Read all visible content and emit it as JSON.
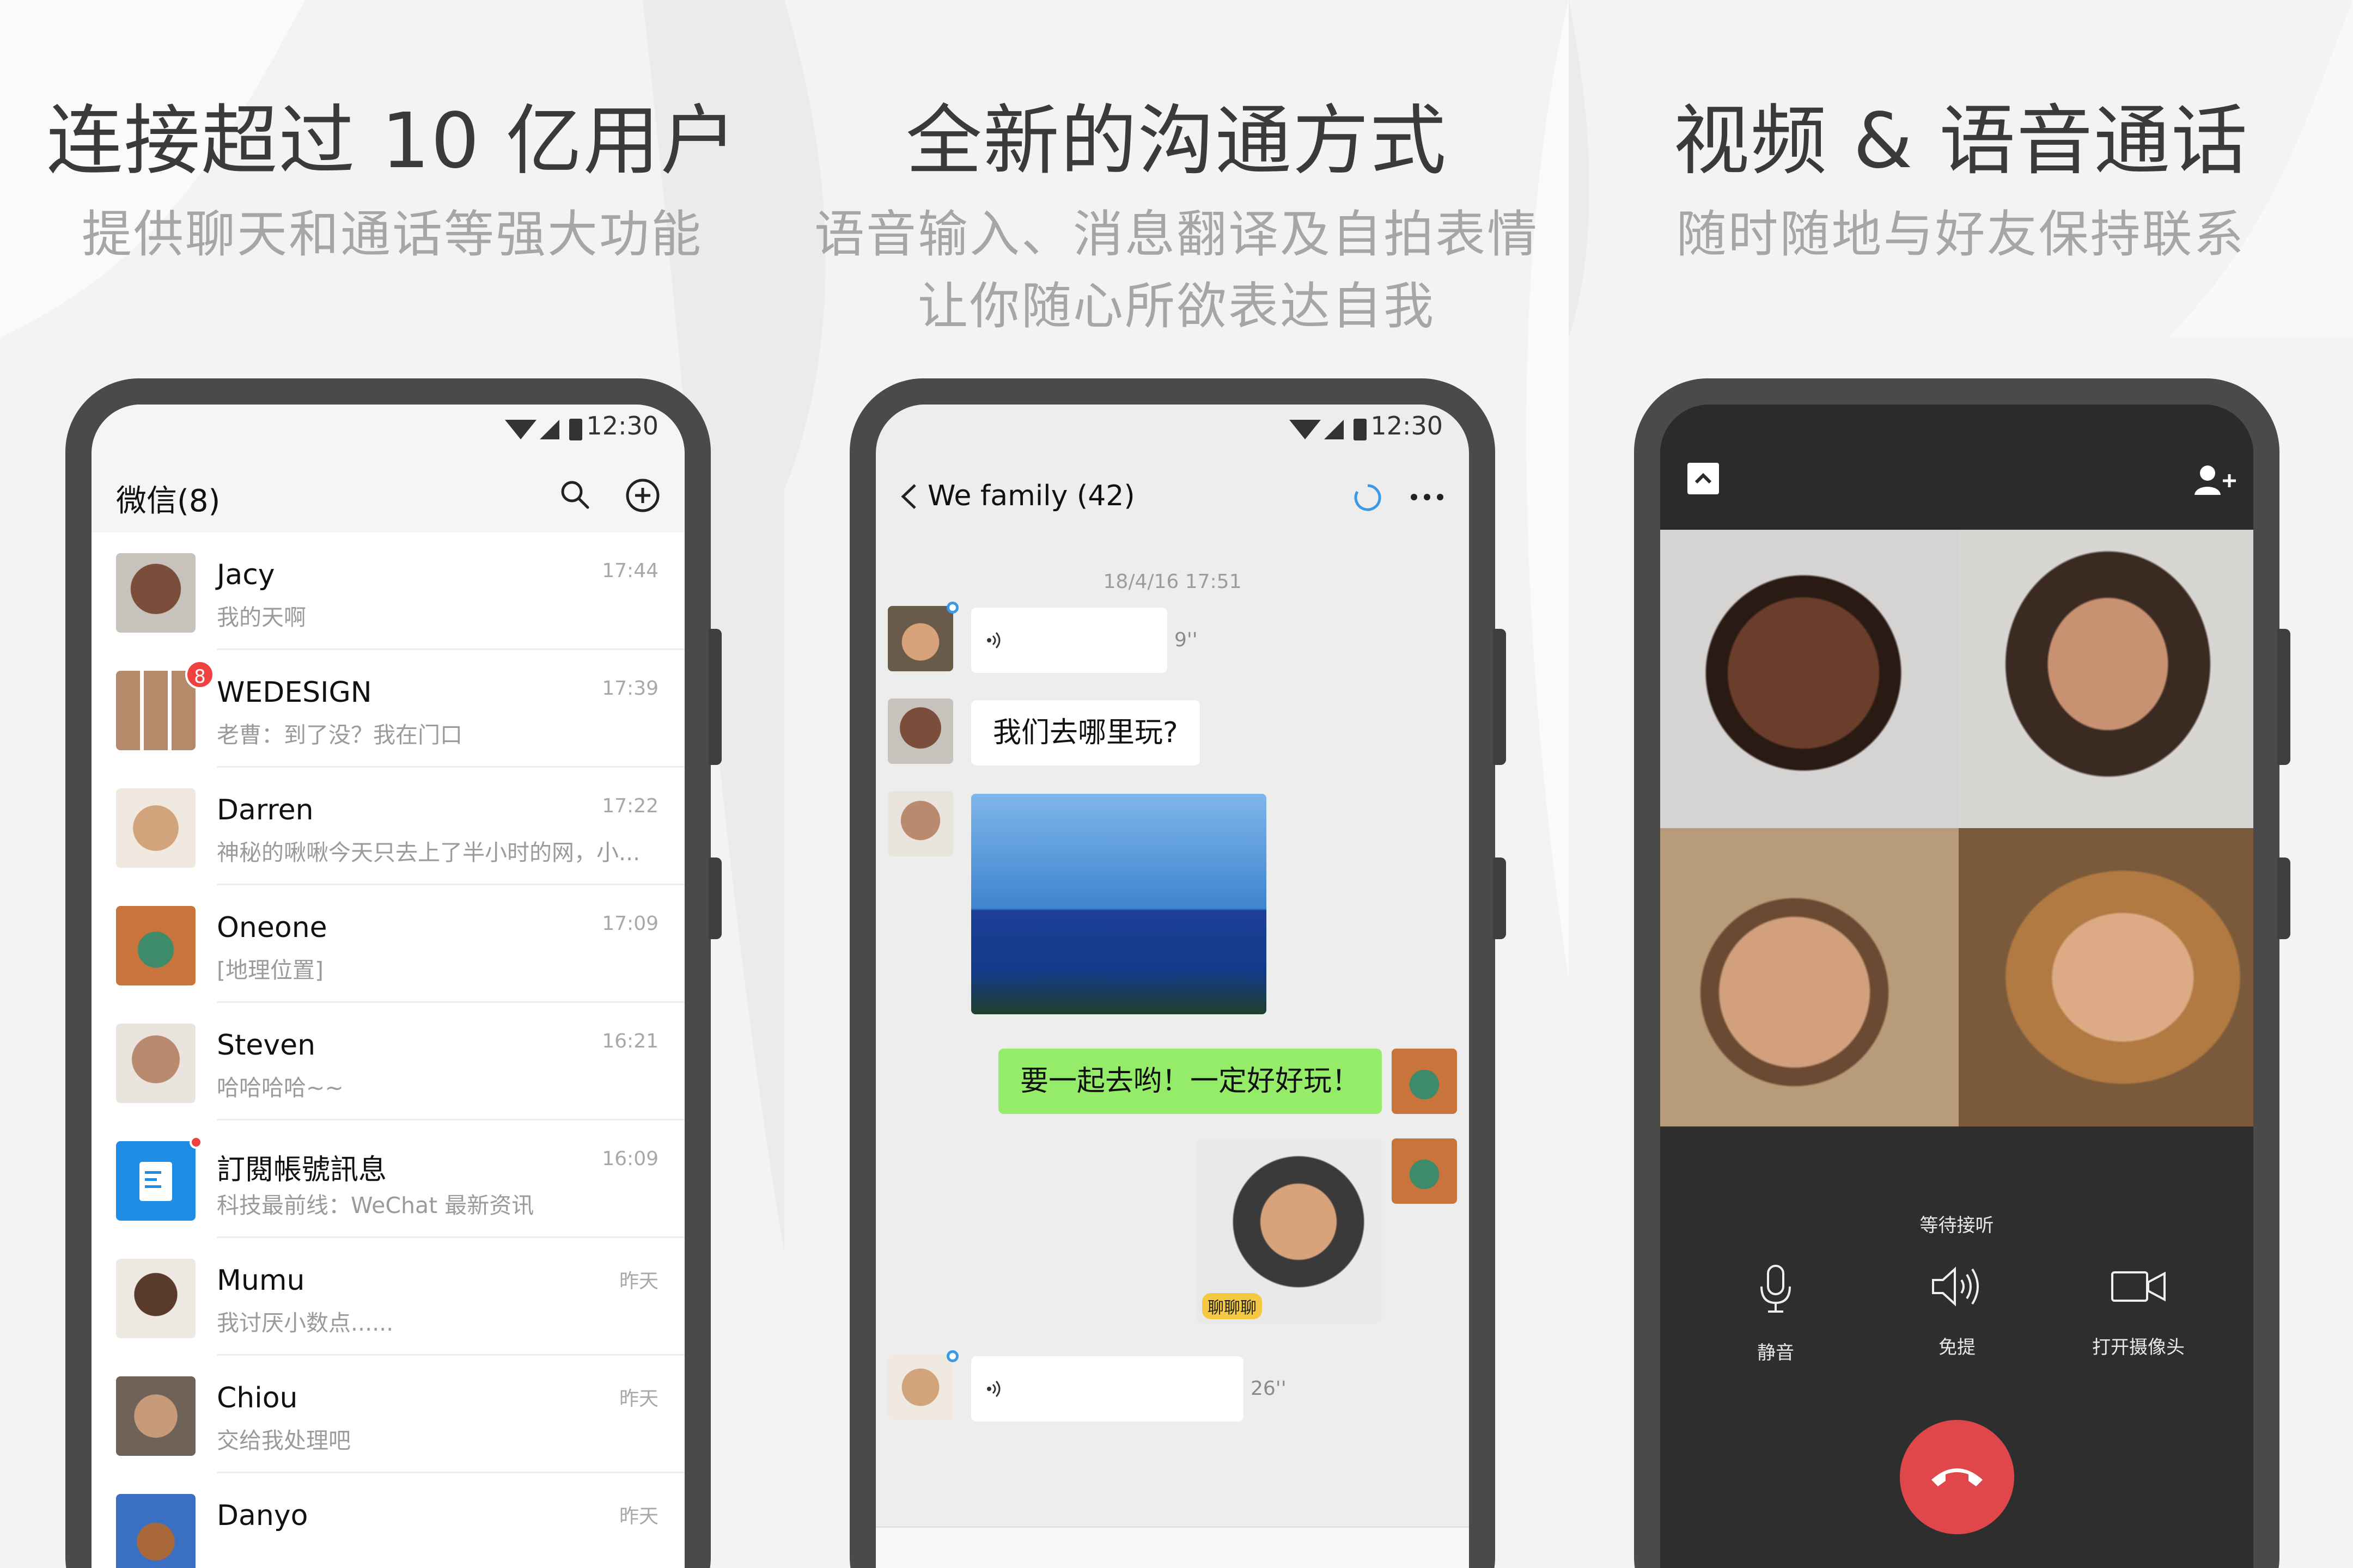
{
  "panels": [
    {
      "title": "连接超过 10 亿用户",
      "subtitle": [
        "提供聊天和通话等强大功能"
      ]
    },
    {
      "title": "全新的沟通方式",
      "subtitle": [
        "语音输入、消息翻译及自拍表情",
        "让你随心所欲表达自我"
      ]
    },
    {
      "title": "视频 & 语音通话",
      "subtitle": [
        "随时随地与好友保持联系"
      ]
    }
  ],
  "status_time": "12:30",
  "chat_list": {
    "title": "微信(8)",
    "icons": [
      "search-icon",
      "add-circle-icon"
    ],
    "chats": [
      {
        "name": "Jacy",
        "message": "我的天啊",
        "time": "17:44",
        "avatar_color": "#6b4a3a"
      },
      {
        "name": "WEDESIGN",
        "message": "老曹：到了没？我在门口",
        "time": "17:39",
        "badge": "8",
        "avatar_color": "#9a7b6a"
      },
      {
        "name": "Darren",
        "message": "神秘的啾啾今天只去上了半小时的网，小...",
        "time": "17:22",
        "avatar_color": "#c9a07f"
      },
      {
        "name": "Oneone",
        "message": "[地理位置]",
        "time": "17:09",
        "avatar_color": "#c8743c"
      },
      {
        "name": "Steven",
        "message": "哈哈哈哈~~",
        "time": "16:21",
        "avatar_color": "#b98a6e"
      },
      {
        "name": "訂閱帳號訊息",
        "message": "科技最前线：WeChat 最新资讯",
        "time": "16:09",
        "dot": true,
        "avatar_color": "#1f8ce6"
      },
      {
        "name": "Mumu",
        "message": "我讨厌小数点......",
        "time": "昨天",
        "avatar_color": "#d9c5b6"
      },
      {
        "name": "Chiou",
        "message": "交给我处理吧",
        "time": "昨天",
        "avatar_color": "#8f7a6a"
      },
      {
        "name": "Danyo",
        "message": "",
        "time": "昨天",
        "avatar_color": "#3a6fc4"
      }
    ]
  },
  "group_chat": {
    "title": "We family (42)",
    "timestamp": "18/4/16 17:51",
    "voice1_duration": "9''",
    "text_message": "我们去哪里玩?",
    "sent_message": "要一起去哟！一定好好玩！",
    "sticker_label": "聊聊聊",
    "voice2_duration": "26''",
    "accent": "#95ec69"
  },
  "video_call": {
    "status": "等待接听",
    "controls": [
      {
        "label": "静音",
        "icon": "microphone-icon"
      },
      {
        "label": "免提",
        "icon": "speaker-icon"
      },
      {
        "label": "打开摄像头",
        "icon": "camera-icon"
      }
    ],
    "hangup_color": "#e0474a"
  }
}
